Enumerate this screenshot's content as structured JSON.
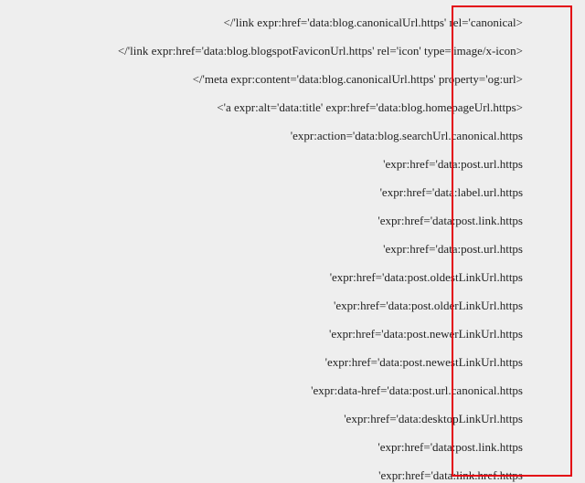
{
  "lines": [
    "</'link expr:href='data:blog.canonicalUrl.https' rel='canonical>",
    "</'link expr:href='data:blog.blogspotFaviconUrl.https' rel='icon' type='image/x-icon>",
    "</'meta expr:content='data:blog.canonicalUrl.https' property='og:url>",
    "<'a expr:alt='data:title' expr:href='data:blog.homepageUrl.https>",
    "'expr:action='data:blog.searchUrl.canonical.https",
    "'expr:href='data:post.url.https",
    "'expr:href='data:label.url.https",
    "'expr:href='data:post.link.https",
    "'expr:href='data:post.url.https",
    "'expr:href='data:post.oldestLinkUrl.https",
    "'expr:href='data:post.olderLinkUrl.https",
    "'expr:href='data:post.newerLinkUrl.https",
    "'expr:href='data:post.newestLinkUrl.https",
    "'expr:data-href='data:post.url.canonical.https",
    "'expr:href='data:desktopLinkUrl.https",
    "'expr:href='data:post.link.https",
    "'expr:href='data:link.href.https"
  ]
}
